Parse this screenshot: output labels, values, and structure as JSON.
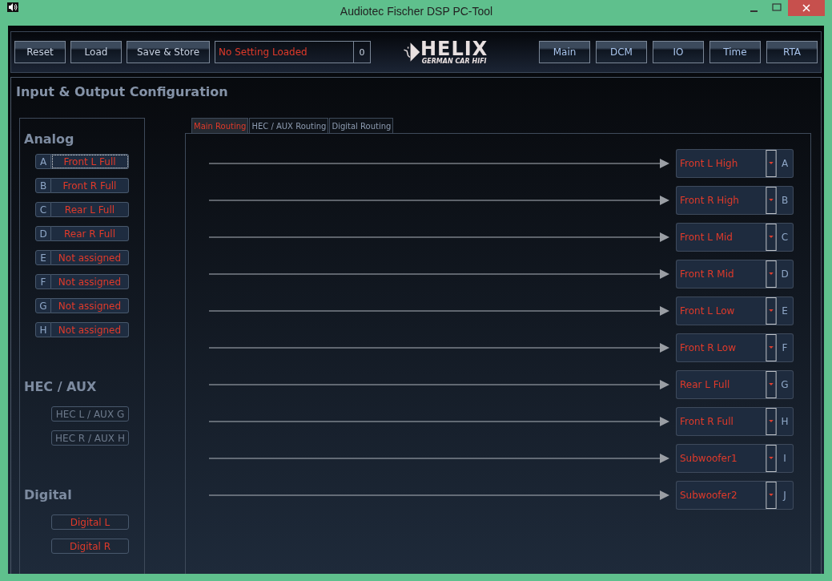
{
  "window": {
    "title": "Audiotec Fischer DSP PC-Tool"
  },
  "toolbar": {
    "buttons": [
      "Reset",
      "Load",
      "Save & Store"
    ],
    "setting_name": "No Setting Loaded",
    "setting_number": "0",
    "logo": {
      "brand": "HELIX",
      "tagline": "GERMAN CAR HIFI"
    },
    "view_buttons": [
      "Main",
      "DCM",
      "IO",
      "Time",
      "RTA"
    ]
  },
  "page": {
    "title": "Input & Output Configuration"
  },
  "inputs": {
    "groups": [
      {
        "title": "Analog",
        "kind": "lettered",
        "items": [
          {
            "letter": "A",
            "name": "Front L Full",
            "focused": true
          },
          {
            "letter": "B",
            "name": "Front R Full",
            "focused": false
          },
          {
            "letter": "C",
            "name": "Rear L Full",
            "focused": false
          },
          {
            "letter": "D",
            "name": "Rear R Full",
            "focused": false
          },
          {
            "letter": "E",
            "name": "Not assigned",
            "focused": false
          },
          {
            "letter": "F",
            "name": "Not assigned",
            "focused": false
          },
          {
            "letter": "G",
            "name": "Not assigned",
            "focused": false
          },
          {
            "letter": "H",
            "name": "Not assigned",
            "focused": false
          }
        ]
      },
      {
        "title": "HEC / AUX",
        "kind": "plain",
        "items": [
          {
            "name": "HEC L / AUX G",
            "disabled": true
          },
          {
            "name": "HEC R / AUX H",
            "disabled": true
          }
        ]
      },
      {
        "title": "Digital",
        "kind": "plain",
        "items": [
          {
            "name": "Digital L",
            "disabled": false
          },
          {
            "name": "Digital R",
            "disabled": false
          }
        ]
      }
    ]
  },
  "routing": {
    "tabs": [
      {
        "label": "Main Routing",
        "selected": true
      },
      {
        "label": "HEC / AUX Routing",
        "selected": false
      },
      {
        "label": "Digital Routing",
        "selected": false
      }
    ],
    "outputs": [
      {
        "source": "Front L High",
        "channel": "A"
      },
      {
        "source": "Front R High",
        "channel": "B"
      },
      {
        "source": "Front L Mid",
        "channel": "C"
      },
      {
        "source": "Front R Mid",
        "channel": "D"
      },
      {
        "source": "Front L Low",
        "channel": "E"
      },
      {
        "source": "Front R Low",
        "channel": "F"
      },
      {
        "source": "Rear L Full",
        "channel": "G"
      },
      {
        "source": "Front R Full",
        "channel": "H"
      },
      {
        "source": "Subwoofer1",
        "channel": "I"
      },
      {
        "source": "Subwoofer2",
        "channel": "J"
      }
    ]
  }
}
